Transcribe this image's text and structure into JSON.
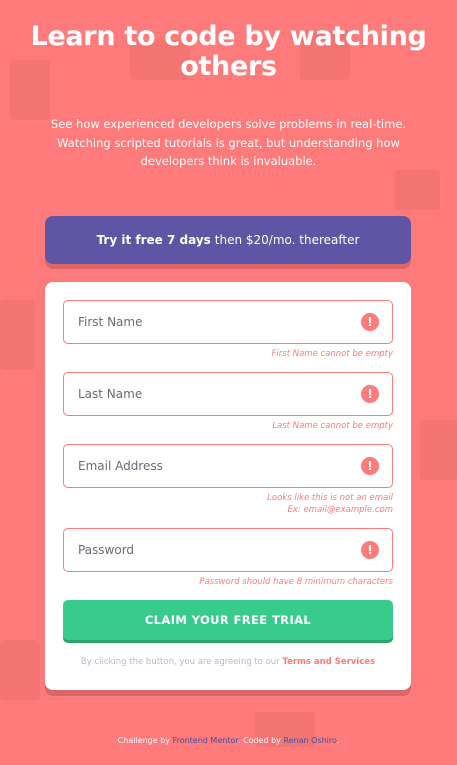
{
  "hero": {
    "title": "Learn to code by watching others",
    "description": "See how experienced developers solve problems in real-time. Watching scripted tutorials is great, but understanding how developers think is invaluable."
  },
  "promo": {
    "bold": "Try it free 7 days",
    "rest": "then $20/mo. thereafter"
  },
  "form": {
    "first_name": {
      "placeholder": "First Name",
      "error": "First Name cannot be empty"
    },
    "last_name": {
      "placeholder": "Last Name",
      "error": "Last Name cannot be empty"
    },
    "email": {
      "placeholder": "Email Address",
      "error_line1": "Looks like this is not an email",
      "error_line2": "Ex: email@example.com"
    },
    "password": {
      "placeholder": "Password",
      "error": "Password should have 8 minimum characters"
    },
    "error_icon": "!",
    "submit_label": "CLAIM YOUR FREE TRIAL",
    "terms_prefix": "By clicking the button, you are agreeing to our",
    "terms_link": "Terms and Services"
  },
  "attribution": {
    "prefix": "Challenge by",
    "link1": "Frontend Mentor",
    "middle": ". Coded by",
    "link2": "Renan Oshiro",
    "suffix": "."
  },
  "colors": {
    "background": "#ff7a7a",
    "promo": "#6055a5",
    "cta": "#38cc8c",
    "error": "#ff7a7a"
  }
}
